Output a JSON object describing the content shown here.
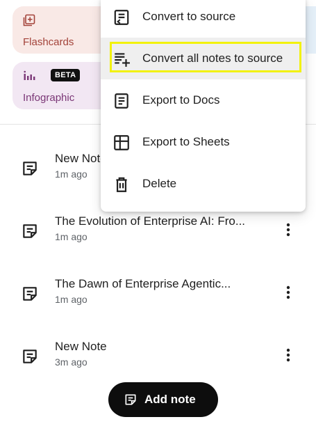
{
  "tiles": {
    "flashcards": {
      "label": "Flashcards",
      "icon": "flashcards-icon"
    },
    "infographic": {
      "label": "Infographic",
      "badge": "BETA",
      "icon": "infographic-icon"
    }
  },
  "notes": [
    {
      "title": "New Note",
      "time": "1m ago"
    },
    {
      "title": "The Evolution of Enterprise AI: Fro...",
      "time": "1m ago"
    },
    {
      "title": "The Dawn of Enterprise Agentic...",
      "time": "1m ago"
    },
    {
      "title": "New Note",
      "time": "3m ago"
    }
  ],
  "add_note_label": "Add note",
  "menu": {
    "items": [
      {
        "label": "Convert to source",
        "icon": "convert-source-icon"
      },
      {
        "label": "Convert all notes to source",
        "icon": "playlist-add-icon",
        "highlighted": true
      },
      {
        "label": "Export to Docs",
        "icon": "docs-icon"
      },
      {
        "label": "Export to Sheets",
        "icon": "sheets-icon"
      },
      {
        "label": "Delete",
        "icon": "trash-icon"
      }
    ]
  },
  "colors": {
    "flashcards_bg": "#f9e9e6",
    "flashcards_text": "#a3433a",
    "infographic_bg": "#f2e7f3",
    "infographic_text": "#7a3676",
    "highlight_border": "#f2f20b",
    "add_note_bg": "#0d0d0d"
  }
}
